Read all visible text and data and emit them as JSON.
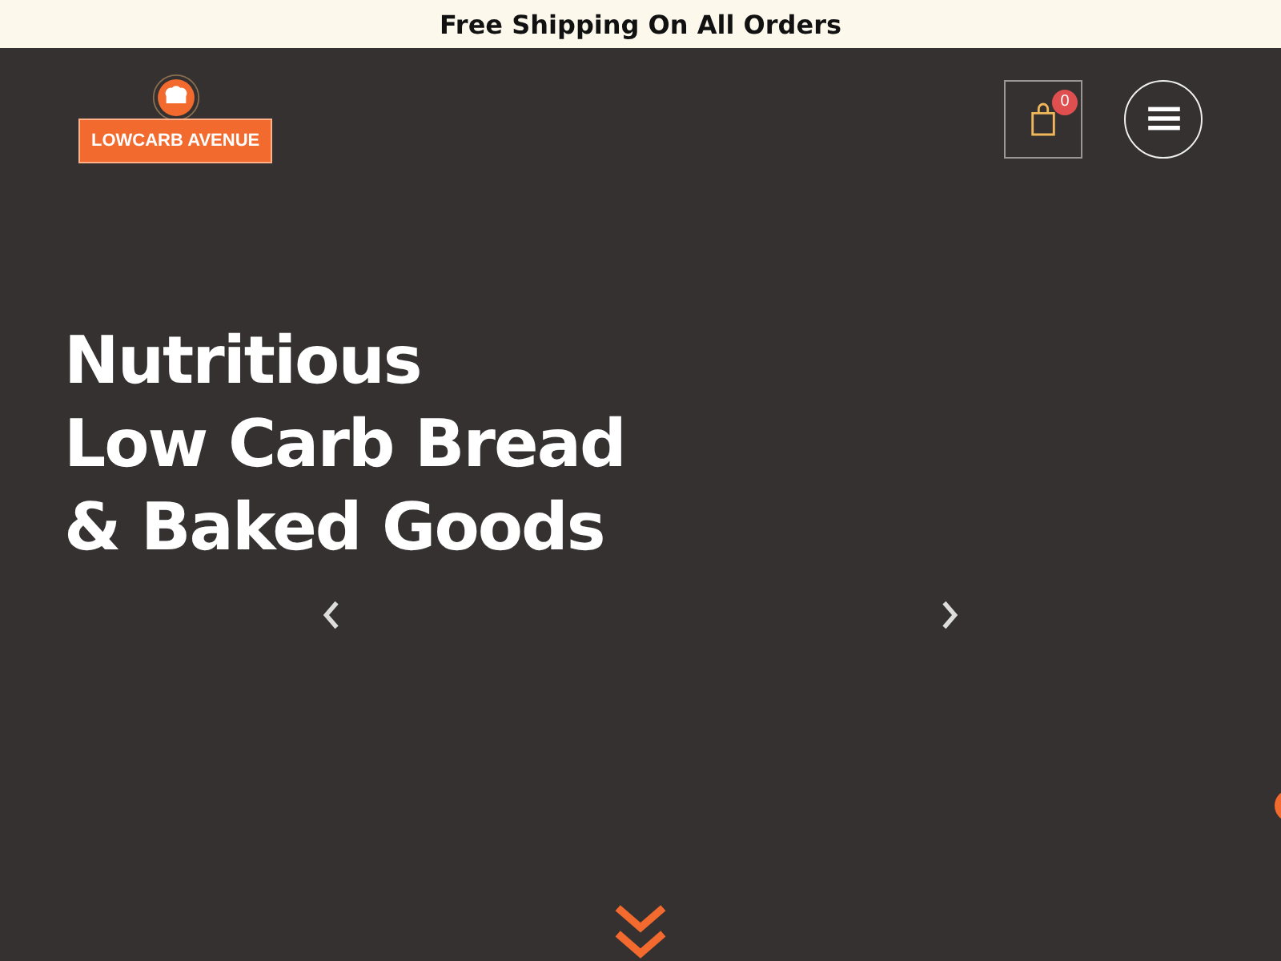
{
  "announcement": "Free Shipping On All Orders",
  "header": {
    "logo_text": "LOWCARB AVENUE",
    "cart_count": "0"
  },
  "hero": {
    "headline": [
      "Nutritious",
      "Low Carb Bread",
      "& Baked Goods"
    ]
  }
}
